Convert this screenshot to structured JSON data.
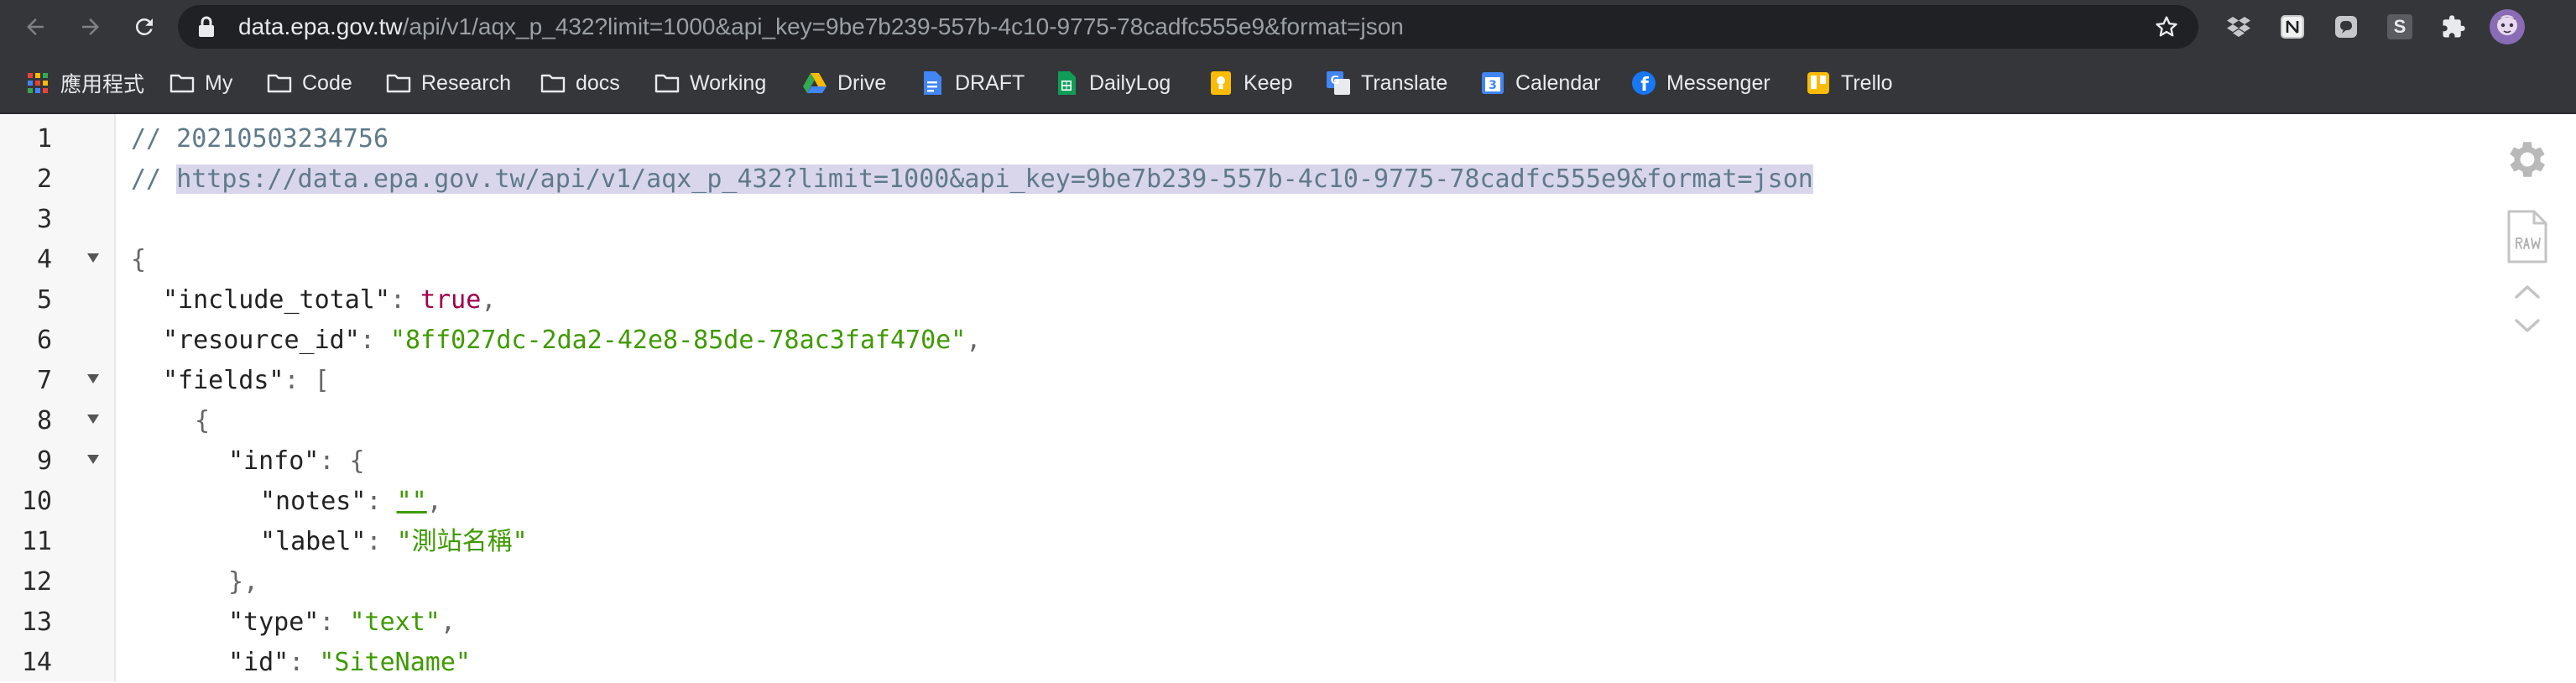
{
  "browser": {
    "url_host": "data.epa.gov.tw",
    "url_rest": "/api/v1/aqx_p_432?limit=1000&api_key=9be7b239-557b-4c10-9775-78cadfc555e9&format=json",
    "ext_s_letter": "S"
  },
  "bookmarks": [
    {
      "label": "應用程式",
      "icon": "apps-grid-icon"
    },
    {
      "label": "My",
      "icon": "folder-icon"
    },
    {
      "label": "Code",
      "icon": "folder-icon"
    },
    {
      "label": "Research",
      "icon": "folder-icon"
    },
    {
      "label": "docs",
      "icon": "folder-icon"
    },
    {
      "label": "Working",
      "icon": "folder-icon"
    },
    {
      "label": "Drive",
      "icon": "drive-icon"
    },
    {
      "label": "DRAFT",
      "icon": "docs-icon"
    },
    {
      "label": "DailyLog",
      "icon": "sheets-icon"
    },
    {
      "label": "Keep",
      "icon": "keep-icon"
    },
    {
      "label": "Translate",
      "icon": "translate-icon"
    },
    {
      "label": "Calendar",
      "icon": "calendar-icon"
    },
    {
      "label": "Messenger",
      "icon": "facebook-icon"
    },
    {
      "label": "Trello",
      "icon": "trello-icon"
    }
  ],
  "bookmark_icon_text": {
    "translate": "G",
    "calendar": "3",
    "facebook": "f"
  },
  "lines": {
    "l1": {
      "num": "1",
      "comment": "// 20210503234756"
    },
    "l2": {
      "num": "2",
      "prefix": "// ",
      "url": "https://data.epa.gov.tw/api/v1/aqx_p_432?limit=1000&api_key=9be7b239-557b-4c10-9775-78cadfc555e9&format=json"
    },
    "l3": {
      "num": "3"
    },
    "l4": {
      "num": "4",
      "text": "{"
    },
    "l5": {
      "num": "5",
      "key": "\"include_total\"",
      "sep": ": ",
      "value": "true",
      "end": ","
    },
    "l6": {
      "num": "6",
      "key": "\"resource_id\"",
      "sep": ": ",
      "value": "\"8ff027dc-2da2-42e8-85de-78ac3faf470e\"",
      "end": ","
    },
    "l7": {
      "num": "7",
      "key": "\"fields\"",
      "sep": ": ",
      "open": "["
    },
    "l8": {
      "num": "8",
      "text": "{"
    },
    "l9": {
      "num": "9",
      "key": "\"info\"",
      "sep": ": ",
      "open": "{"
    },
    "l10": {
      "num": "10",
      "key": "\"notes\"",
      "sep": ": ",
      "value": "\"\"",
      "end": ","
    },
    "l11": {
      "num": "11",
      "key": "\"label\"",
      "sep": ": ",
      "value": "\"測站名稱\""
    },
    "l12": {
      "num": "12",
      "text": "},"
    },
    "l13": {
      "num": "13",
      "key": "\"type\"",
      "sep": ": ",
      "value": "\"text\"",
      "end": ","
    },
    "l14": {
      "num": "14",
      "key": "\"id\"",
      "sep": ": ",
      "value": "\"SiteName\""
    }
  },
  "colors": {
    "chrome_bg": "#35363a",
    "omnibox_bg": "#202124",
    "json_key": "#222222",
    "json_string": "#3f9a00",
    "json_bool": "#a0004a",
    "comment": "#5f7a8a",
    "url_highlight": "#d9d6ec"
  }
}
